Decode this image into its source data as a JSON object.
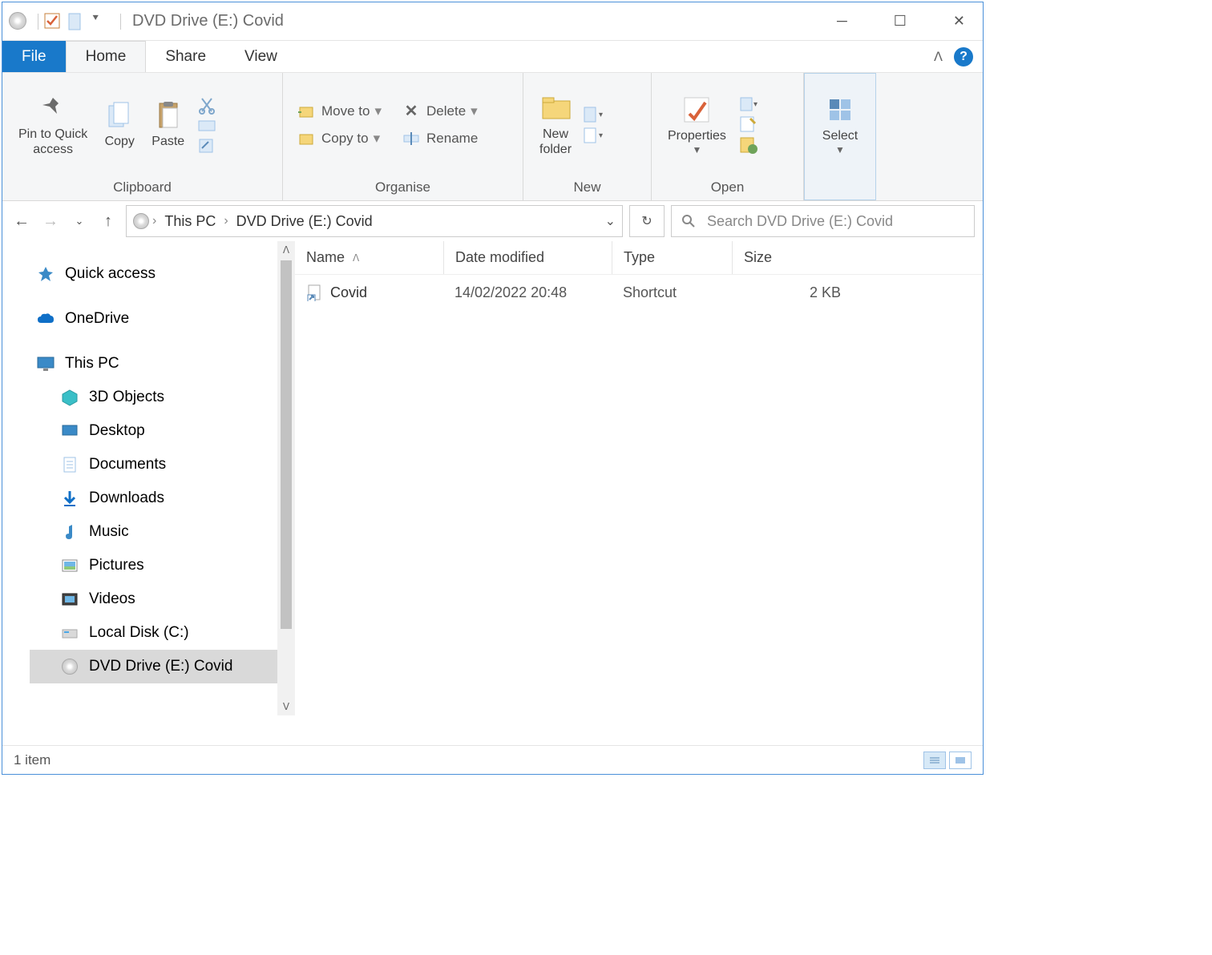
{
  "titlebar": {
    "title": "DVD Drive (E:) Covid"
  },
  "menu": {
    "file": "File",
    "home": "Home",
    "share": "Share",
    "view": "View"
  },
  "ribbon": {
    "pin": "Pin to Quick\naccess",
    "copy": "Copy",
    "paste": "Paste",
    "clipboard_label": "Clipboard",
    "move_to": "Move to",
    "copy_to": "Copy to",
    "delete": "Delete",
    "rename": "Rename",
    "organise_label": "Organise",
    "new_folder": "New\nfolder",
    "new_label": "New",
    "properties": "Properties",
    "open_label": "Open",
    "select": "Select"
  },
  "breadcrumb": {
    "p1": "This PC",
    "p2": "DVD Drive (E:) Covid"
  },
  "search": {
    "placeholder": "Search DVD Drive (E:) Covid"
  },
  "tree": {
    "quick_access": "Quick access",
    "onedrive": "OneDrive",
    "this_pc": "This PC",
    "objects3d": "3D Objects",
    "desktop": "Desktop",
    "documents": "Documents",
    "downloads": "Downloads",
    "music": "Music",
    "pictures": "Pictures",
    "videos": "Videos",
    "local_disk": "Local Disk (C:)",
    "dvd_drive": "DVD Drive (E:) Covid"
  },
  "columns": {
    "name": "Name",
    "date": "Date modified",
    "type": "Type",
    "size": "Size"
  },
  "rows": [
    {
      "name": "Covid",
      "date": "14/02/2022 20:48",
      "type": "Shortcut",
      "size": "2 KB"
    }
  ],
  "status": {
    "count": "1 item"
  }
}
